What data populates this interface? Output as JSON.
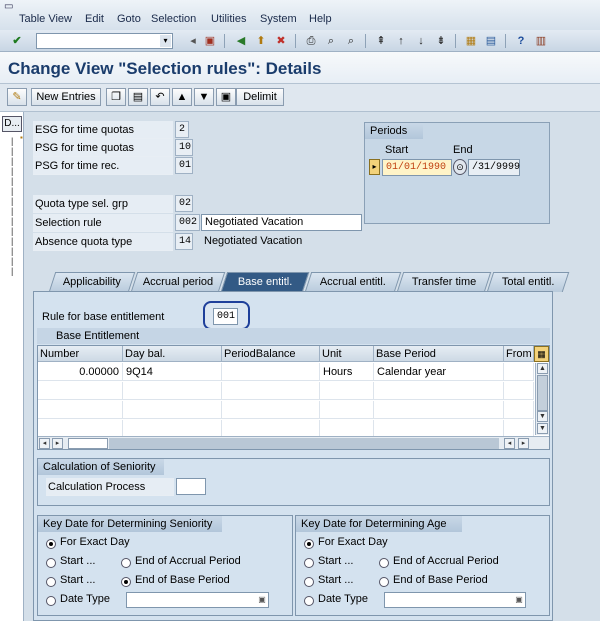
{
  "menubar": {
    "items": [
      "Table View",
      "Edit",
      "Goto",
      "Selection",
      "Utilities",
      "System",
      "Help"
    ]
  },
  "toolbar": {
    "command_value": ""
  },
  "page_title": "Change View \"Selection rules\": Details",
  "app_toolbar": {
    "new_entries": "New Entries",
    "delimit": "Delimit"
  },
  "left_pane": {
    "header": "D..."
  },
  "fields": {
    "esg_time_quotas": {
      "label": "ESG for time quotas",
      "value": "2"
    },
    "psg_time_quotas": {
      "label": "PSG for time quotas",
      "value": "10"
    },
    "psg_time_rec": {
      "label": "PSG for time rec.",
      "value": "01"
    },
    "quota_type_sel_grp": {
      "label": "Quota type sel. grp",
      "value": "02"
    },
    "selection_rule": {
      "label": "Selection rule",
      "value": "002",
      "text": "Negotiated Vacation"
    },
    "absence_quota_type": {
      "label": "Absence quota type",
      "value": "14",
      "text": "Negotiated Vacation"
    }
  },
  "periods": {
    "title": "Periods",
    "start_label": "Start",
    "end_label": "End",
    "start_value": "01/01/1990",
    "end_value": "/31/9999"
  },
  "tabs": [
    {
      "label": "Applicability",
      "active": false
    },
    {
      "label": "Accrual period",
      "active": false
    },
    {
      "label": "Base entitl.",
      "active": true
    },
    {
      "label": "Accrual entitl.",
      "active": false
    },
    {
      "label": "Transfer time",
      "active": false
    },
    {
      "label": "Total entitl.",
      "active": false
    }
  ],
  "base_entitlement": {
    "rule_label": "Rule for base entitlement",
    "rule_value": "001",
    "table_title": "Base Entitlement",
    "columns": [
      "Number",
      "Day bal.",
      "PeriodBalance",
      "Unit",
      "Base Period",
      "From"
    ],
    "rows": [
      [
        "0.00000",
        "9Q14",
        "",
        "Hours",
        "Calendar year",
        ""
      ],
      [
        "",
        "",
        "",
        "",
        "",
        ""
      ],
      [
        "",
        "",
        "",
        "",
        "",
        ""
      ],
      [
        "",
        "",
        "",
        "",
        "",
        ""
      ]
    ]
  },
  "seniority_calc": {
    "title": "Calculation of Seniority",
    "process_label": "Calculation Process",
    "process_value": ""
  },
  "key_date_seniority": {
    "title": "Key Date for Determining Seniority",
    "opt_exact_day": "For Exact Day",
    "opt_start1": "Start ...",
    "opt_end_accrual": "End of Accrual Period",
    "opt_start2": "Start ...",
    "opt_end_base": "End of Base Period",
    "opt_date_type": "Date Type",
    "selected": "End of Base Period"
  },
  "key_date_age": {
    "title": "Key Date for Determining Age",
    "opt_exact_day": "For Exact Day",
    "opt_start1": "Start ...",
    "opt_end_accrual": "End of Accrual Period",
    "opt_start2": "Start ...",
    "opt_end_base": "End of Base Period",
    "opt_date_type": "Date Type",
    "selected": "For Exact Day"
  }
}
